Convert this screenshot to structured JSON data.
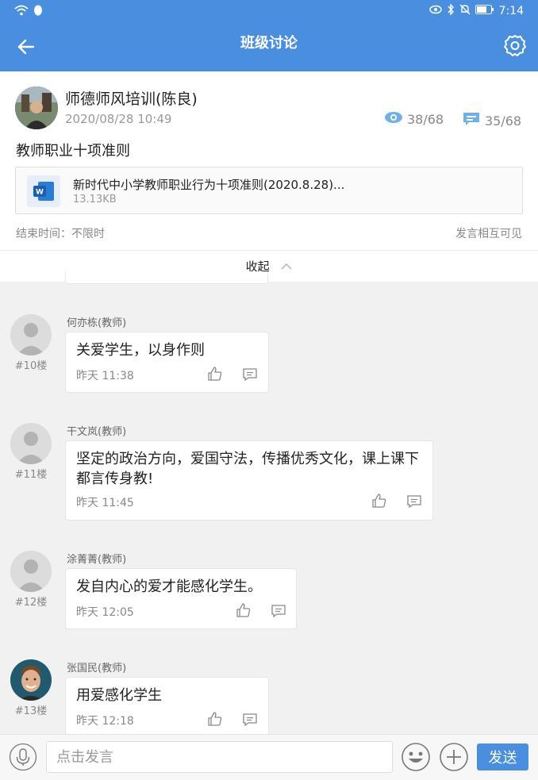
{
  "status": {
    "time": "7:14",
    "icons": [
      "wifi-icon",
      "qq-icon",
      "eye-icon",
      "bluetooth-icon",
      "mute-icon",
      "battery-icon"
    ]
  },
  "header": {
    "title": "班级讨论",
    "accent": "#4a8ee0"
  },
  "post": {
    "author": "师德师风培训(陈良)",
    "date": "2020/08/28  10:49",
    "views": "38/68",
    "replies": "35/68",
    "headline": "教师职业十项准则",
    "attachment": {
      "name": "新时代中小学教师职业行为十项准则(2020.8.28)...",
      "size": "13.13KB",
      "icon": "word-file-icon"
    },
    "end_time": "结束时间：不限时",
    "visibility": "发言相互可见",
    "collapse_label": "收起"
  },
  "comments": [
    {
      "name": "何亦栋(教师)",
      "floor": "#10楼",
      "text": "关爱学生，以身作则",
      "time": "昨天  11:38"
    },
    {
      "name": "干文岚(教师)",
      "floor": "#11楼",
      "text": "坚定的政治方向，爱国守法，传播优秀文化，课上课下都言传身教!",
      "time": "昨天  11:45"
    },
    {
      "name": "涂菁菁(教师)",
      "floor": "#12楼",
      "text": "发自内心的爱才能感化学生。",
      "time": "昨天  12:05"
    },
    {
      "name": "张国民(教师)",
      "floor": "#13楼",
      "text": "用爱感化学生",
      "time": "昨天  12:18"
    }
  ],
  "composer": {
    "placeholder": "点击发言",
    "send_label": "发送"
  }
}
